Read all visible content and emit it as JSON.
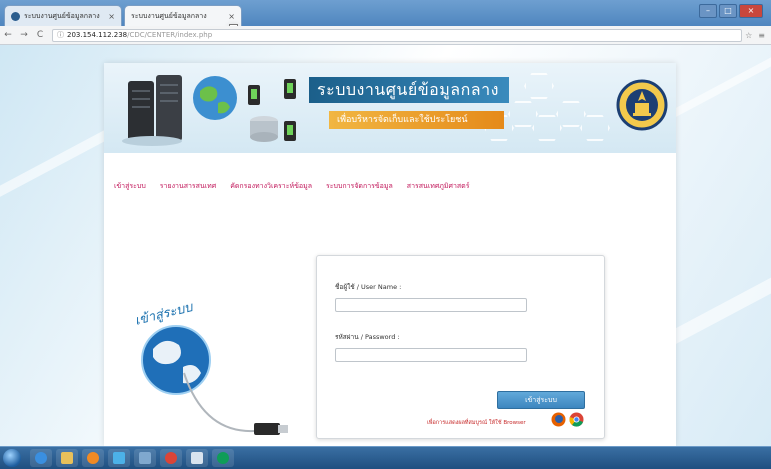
{
  "browser": {
    "tabs": [
      {
        "title": "ระบบงานศูนย์ข้อมูลกลาง",
        "active": false
      },
      {
        "title": "ระบบงานศูนย์ข้อมูลกลาง",
        "active": true
      }
    ],
    "tab_close": "×",
    "address_host": "203.154.112.238",
    "address_path": "/CDC/CENTER/index.php",
    "nav_back": "←",
    "nav_forward": "→",
    "nav_reload": "C",
    "toolbar_icons": [
      "☆",
      "≡"
    ]
  },
  "banner": {
    "title": "ระบบงานศูนย์ข้อมูลกลาง",
    "subtitle": "เพื่อบริหารจัดเก็บและใช้ประโยชน์"
  },
  "menu": {
    "items": [
      "เข้าสู่ระบบ",
      "รายงานสารสนเทศ",
      "คัดกรองทางวิเคราะห์ข้อมูล",
      "ระบบการจัดการข้อมูล",
      "สารสนเทศภูมิศาสตร์"
    ]
  },
  "left_illustration": {
    "caption": "เข้าสู่ระบบ"
  },
  "login": {
    "username_label": "ชื่อผู้ใช้ / User Name :",
    "username_value": "",
    "password_label": "รหัสผ่าน / Password :",
    "password_value": "",
    "submit_label": "เข้าสู่ระบบ",
    "browser_note": "เพื่อการแสดงผลที่สมบูรณ์ ให้ใช้ Browser"
  },
  "colors": {
    "accent": "#1e73b0",
    "menu_link": "#c2185b",
    "note": "#c62828",
    "button": "#3d86bf"
  },
  "taskbar": {
    "tray_text": ""
  }
}
